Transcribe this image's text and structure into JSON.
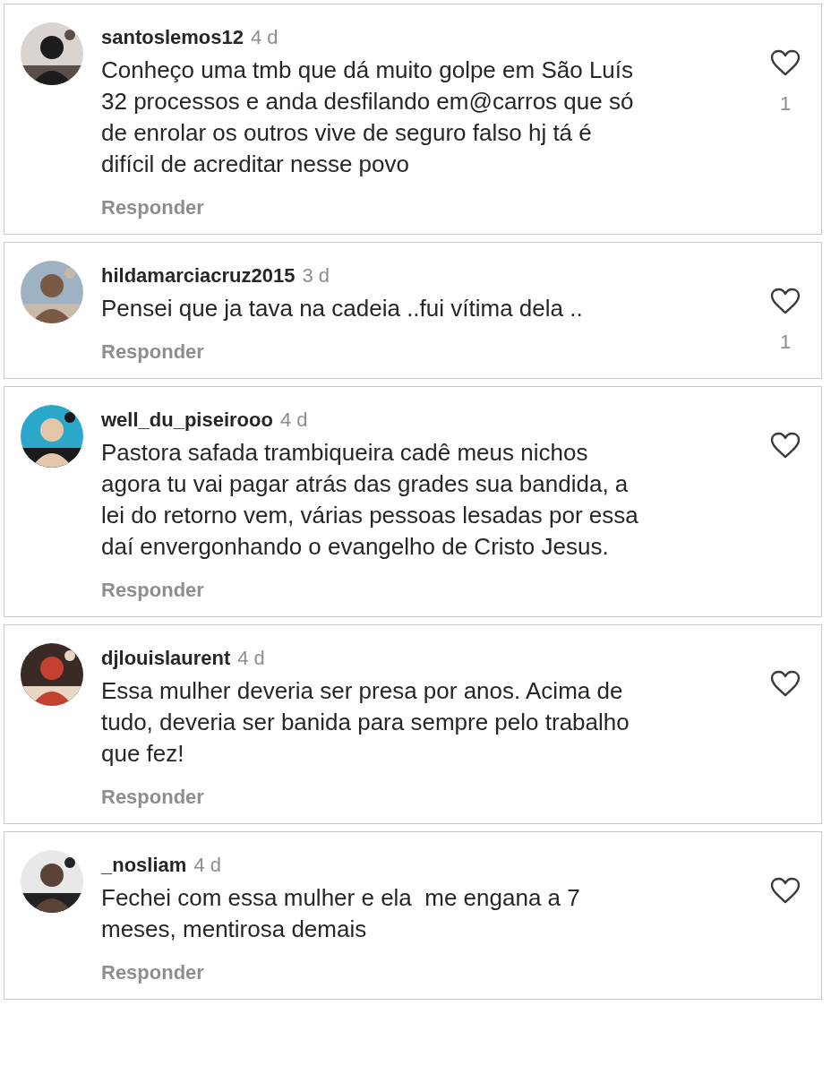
{
  "comments": [
    {
      "username": "santoslemos12",
      "time": "4 d",
      "lines": [
        "Conheço uma tmb que dá muito golpe em São Luís",
        "32 processos e anda desfilando em@carros que só",
        "de enrolar os outros vive de seguro falso hj tá é",
        "difícil de acreditar nesse povo"
      ],
      "reply": "Responder",
      "likes": "1"
    },
    {
      "username": "hildamarciacruz2015",
      "time": "3 d",
      "lines": [
        "Pensei que ja tava na cadeia ..fui vítima dela .."
      ],
      "reply": "Responder",
      "likes": "1"
    },
    {
      "username": "well_du_piseirooo",
      "time": "4 d",
      "lines": [
        "Pastora safada trambiqueira cadê meus nichos",
        "agora tu vai pagar atrás das grades sua bandida, a",
        "lei do retorno vem, várias pessoas lesadas por essa",
        "daí envergonhando o evangelho de Cristo Jesus."
      ],
      "reply": "Responder"
    },
    {
      "username": "djlouislaurent",
      "time": "4 d",
      "lines": [
        "Essa mulher deveria ser presa por anos. Acima de",
        "tudo, deveria ser banida para sempre pelo trabalho",
        "que fez!"
      ],
      "reply": "Responder"
    },
    {
      "username": "_nosliam",
      "time": "4 d",
      "lines": [
        "Fechei com essa mulher e ela  me engana a 7",
        "meses, mentirosa demais"
      ],
      "reply": "Responder"
    }
  ]
}
